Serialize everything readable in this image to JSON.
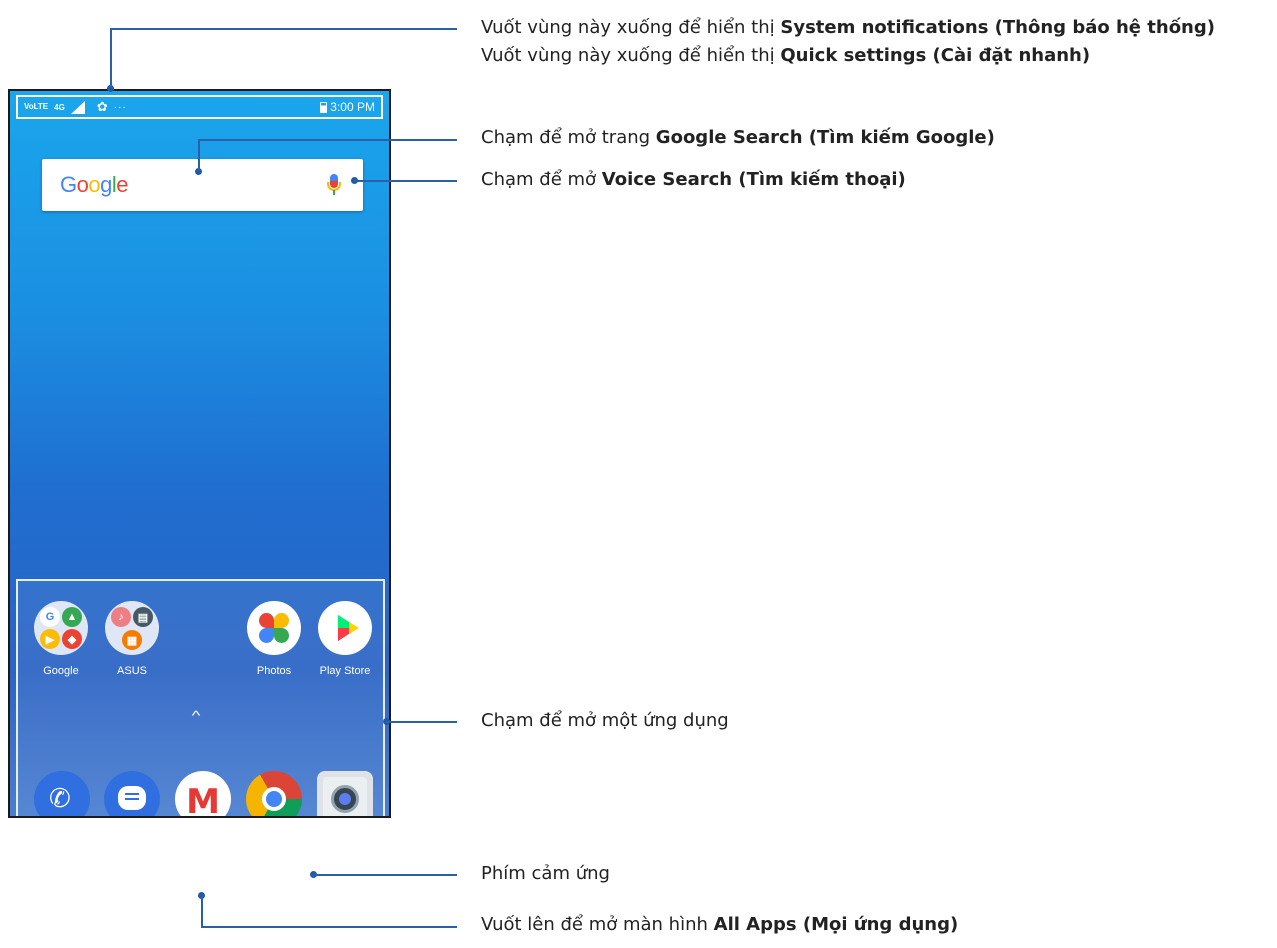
{
  "status_bar": {
    "volte": "VoLTE",
    "network": "4G",
    "dots": "···",
    "time": "3:00 PM"
  },
  "search": {
    "logo_letters": [
      {
        "ch": "G",
        "color": "#4285f4"
      },
      {
        "ch": "o",
        "color": "#ea4335"
      },
      {
        "ch": "o",
        "color": "#fbbc05"
      },
      {
        "ch": "g",
        "color": "#4285f4"
      },
      {
        "ch": "l",
        "color": "#34a853"
      },
      {
        "ch": "e",
        "color": "#ea4335"
      }
    ]
  },
  "home_apps": [
    {
      "label": "Google"
    },
    {
      "label": "ASUS"
    },
    {
      "label": "Photos"
    },
    {
      "label": "Play Store"
    }
  ],
  "callouts": {
    "status_1_pre": "Vuốt vùng này xuống để hiển thị ",
    "status_1_bold": "System notifications (Thông báo hệ thống)",
    "status_2_pre": "Vuốt vùng này xuống để hiển thị ",
    "status_2_bold": "Quick settings (Cài đặt nhanh)",
    "search_pre": "Chạm để mở trang ",
    "search_bold": "Google Search (Tìm kiếm Google)",
    "voice_pre": "Chạm để mở ",
    "voice_bold": "Voice Search (Tìm kiếm thoại)",
    "app": "Chạm để mở một ứng dụng",
    "keys": "Phím cảm ứng",
    "allapps_pre": "Vuốt lên để mở màn hình ",
    "allapps_bold": "All Apps (Mọi ứng dụng)"
  },
  "colors": {
    "callout_line": "#2b5fa8",
    "wallpaper_top": "#1aa6ec",
    "wallpaper_bottom": "#4a7ed0"
  }
}
